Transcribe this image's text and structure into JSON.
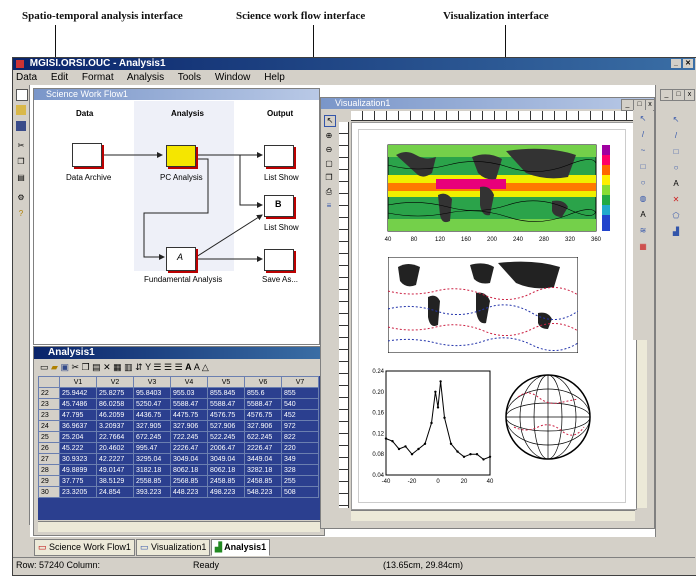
{
  "captions": {
    "left": "Spatio-temporal analysis interface",
    "middle": "Science work flow interface",
    "right": "Visualization interface"
  },
  "app": {
    "title": "MGISI.ORSI.OUC - Analysis1"
  },
  "menu": [
    "Data",
    "Edit",
    "Format",
    "Analysis",
    "Tools",
    "Window",
    "Help"
  ],
  "workflow": {
    "title": "Science Work Flow1",
    "headers": {
      "data": "Data",
      "analysis": "Analysis",
      "output": "Output"
    },
    "nodes": {
      "data_archive": "Data Archive",
      "pc_analysis": "PC Analysis",
      "list_show_1": "List Show",
      "list_show_2": "List Show",
      "fundamental": "Fundamental Analysis",
      "save_as": "Save As..."
    },
    "list_show_2_glyph": "B",
    "fundamental_glyph": "A"
  },
  "visualization": {
    "title": "Visualization1",
    "map1_xticks": [
      "40",
      "80",
      "120",
      "160",
      "200",
      "240",
      "280",
      "320",
      "360"
    ],
    "line_chart": {
      "yticks": [
        "0.24",
        "0.20",
        "0.16",
        "0.12",
        "0.08",
        "0.04"
      ],
      "xticks": [
        "-40",
        "-20",
        "0",
        "20",
        "40"
      ]
    }
  },
  "chart_data": {
    "type": "line",
    "x": [
      -40,
      -35,
      -30,
      -25,
      -20,
      -15,
      -10,
      -5,
      -2,
      0,
      2,
      5,
      10,
      15,
      20,
      25,
      30,
      35,
      40
    ],
    "y": [
      0.11,
      0.105,
      0.09,
      0.095,
      0.08,
      0.09,
      0.1,
      0.14,
      0.2,
      0.17,
      0.22,
      0.15,
      0.1,
      0.085,
      0.075,
      0.08,
      0.08,
      0.07,
      0.075
    ],
    "xlim": [
      -40,
      40
    ],
    "ylim": [
      0.04,
      0.24
    ],
    "xticks": [
      -40,
      -20,
      0,
      20,
      40
    ],
    "yticks": [
      0.04,
      0.08,
      0.12,
      0.16,
      0.2,
      0.24
    ]
  },
  "analysis": {
    "title": "Analysis1",
    "columns": [
      "",
      "V1",
      "V2",
      "V3",
      "V4",
      "V5",
      "V6",
      "V7"
    ],
    "rows": [
      [
        "22",
        "25.9442",
        "25.8275",
        "95.8403",
        "955.03",
        "855.845",
        "855.6",
        "855"
      ],
      [
        "23",
        "45.7486",
        "86.0258",
        "5250.47",
        "5588.47",
        "5588.47",
        "5588.47",
        "540"
      ],
      [
        "23",
        "47.795",
        "46.2059",
        "4436.75",
        "4475.75",
        "4576.75",
        "4576.75",
        "452"
      ],
      [
        "24",
        "36.9637",
        "3.20937",
        "327.905",
        "327.906",
        "527.906",
        "327.906",
        "972"
      ],
      [
        "25",
        "25.204",
        "22.7664",
        "672.245",
        "722.245",
        "522.245",
        "622.245",
        "822"
      ],
      [
        "26",
        "45.222",
        "20.4602",
        "995.47",
        "2226.47",
        "2006.47",
        "2226.47",
        "220"
      ],
      [
        "27",
        "30.9323",
        "42.2227",
        "3295.04",
        "3049.04",
        "3049.04",
        "3449.04",
        "349"
      ],
      [
        "28",
        "49.8899",
        "49.0147",
        "3182.18",
        "8062.18",
        "8062.18",
        "3282.18",
        "328"
      ],
      [
        "29",
        "37.775",
        "38.5129",
        "2558.85",
        "2568.85",
        "2458.85",
        "2458.85",
        "255"
      ],
      [
        "30",
        "23.3205",
        "24.854",
        "393.223",
        "448.223",
        "498.223",
        "548.223",
        "508"
      ]
    ]
  },
  "tabs": [
    "Science Work Flow1",
    "Visualization1",
    "Analysis1"
  ],
  "status": {
    "position": "Row: 57240  Column:",
    "state": "Ready",
    "coords": "(13.65cm, 29.84cm)"
  }
}
